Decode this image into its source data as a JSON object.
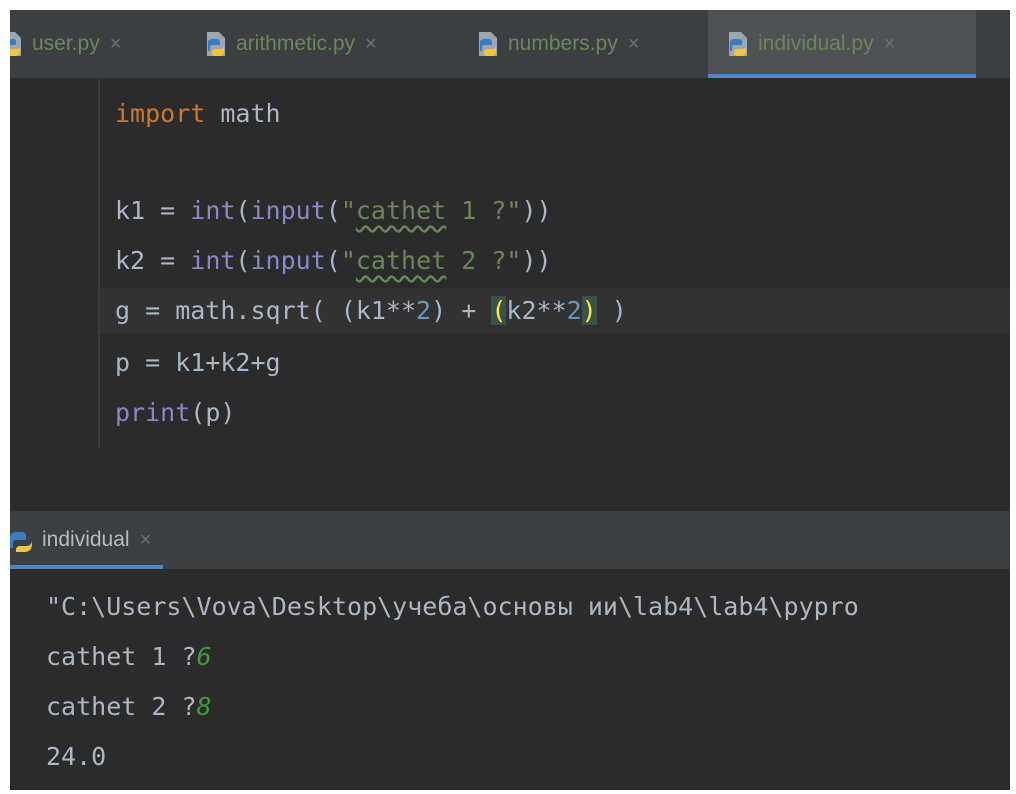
{
  "tabs": [
    {
      "label": "user.py",
      "active": false
    },
    {
      "label": "arithmetic.py",
      "active": false
    },
    {
      "label": "numbers.py",
      "active": false
    },
    {
      "label": "individual.py",
      "active": true
    }
  ],
  "tab_close_glyph": "×",
  "code": {
    "line1": {
      "kw": "import",
      "rest": " math"
    },
    "line3": {
      "a": "k1 = ",
      "int": "int",
      "p1": "(",
      "input": "input",
      "p2": "(",
      "q1": "\"",
      "wav": "cathet",
      "s": " 1 ?\"",
      "p3": "))"
    },
    "line4": {
      "a": "k2 = ",
      "int": "int",
      "p1": "(",
      "input": "input",
      "p2": "(",
      "q1": "\"",
      "wav": "cathet",
      "s": " 2 ?\"",
      "p3": "))"
    },
    "line5": {
      "a": "g = math.sqrt( ",
      "b": "(k1**",
      "n1": "2",
      "c": ") + ",
      "o": "(",
      "d": "k2**",
      "n2": "2",
      "cl": ")",
      "e": " )"
    },
    "line6": {
      "text": "p = k1+k2+g"
    },
    "line7": {
      "fn": "print",
      "args": "(p)"
    }
  },
  "run_tab": {
    "label": "individual"
  },
  "console": {
    "path_line": "\"C:\\Users\\Vova\\Desktop\\учеба\\основы ии\\lab4\\lab4\\pypro",
    "prompt1": "cathet 1 ?",
    "input1": "6",
    "prompt2": "cathet 2 ?",
    "input2": "8",
    "result": "24.0"
  },
  "colors": {
    "editor_bg": "#2b2b2b",
    "keyword": "#cc7832",
    "string": "#6a8759",
    "builtin": "#8888c6",
    "number": "#6897bb",
    "user_input": "#3e9b3e",
    "accent": "#4a88c7"
  },
  "icons": [
    "python-file-icon",
    "close-icon",
    "python-run-icon"
  ]
}
